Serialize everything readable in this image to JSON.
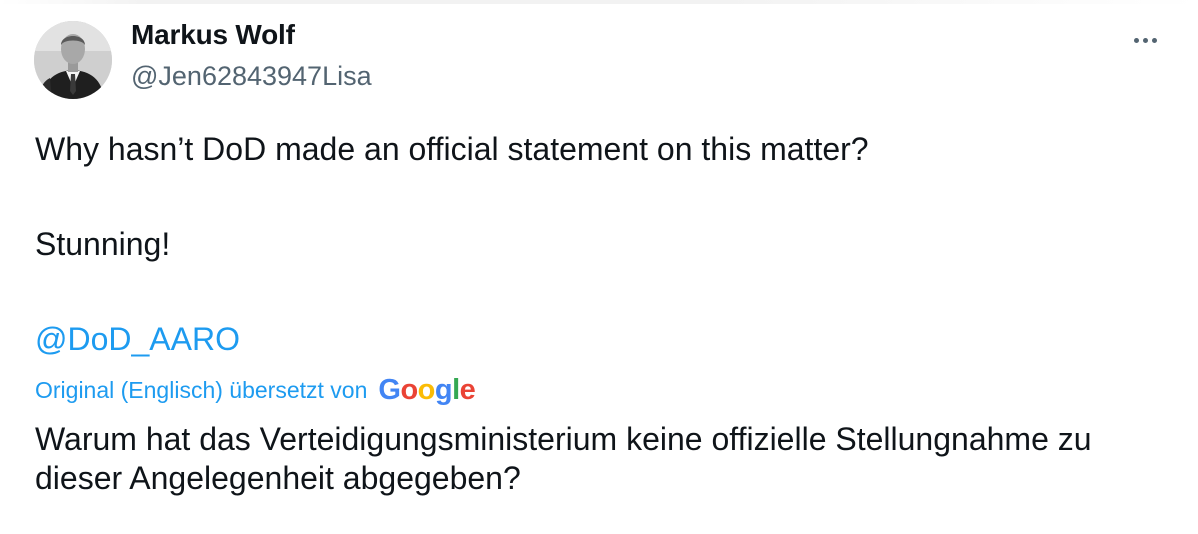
{
  "author": {
    "display_name": "Markus Wolf",
    "handle": "@Jen62843947Lisa"
  },
  "tweet": {
    "line1": "Why hasn’t DoD made an official statement on this matter?",
    "line2": "Stunning!",
    "mention": "@DoD_AARO"
  },
  "translation": {
    "label": "Original (Englisch) übersetzt von",
    "provider_letters": [
      "G",
      "o",
      "o",
      "g",
      "l",
      "e"
    ],
    "provider_colors": [
      "#4285f4",
      "#ea4335",
      "#fbbc05",
      "#4285f4",
      "#34a853",
      "#ea4335"
    ],
    "text": "Warum hat das Verteidigungsministerium keine offizielle Stellungnahme zu dieser Angelegenheit abgegeben?"
  },
  "icons": {
    "more": "more-horizontal-icon"
  },
  "colors": {
    "text_primary": "#0f1419",
    "text_secondary": "#536471",
    "link": "#1d9bf0"
  }
}
